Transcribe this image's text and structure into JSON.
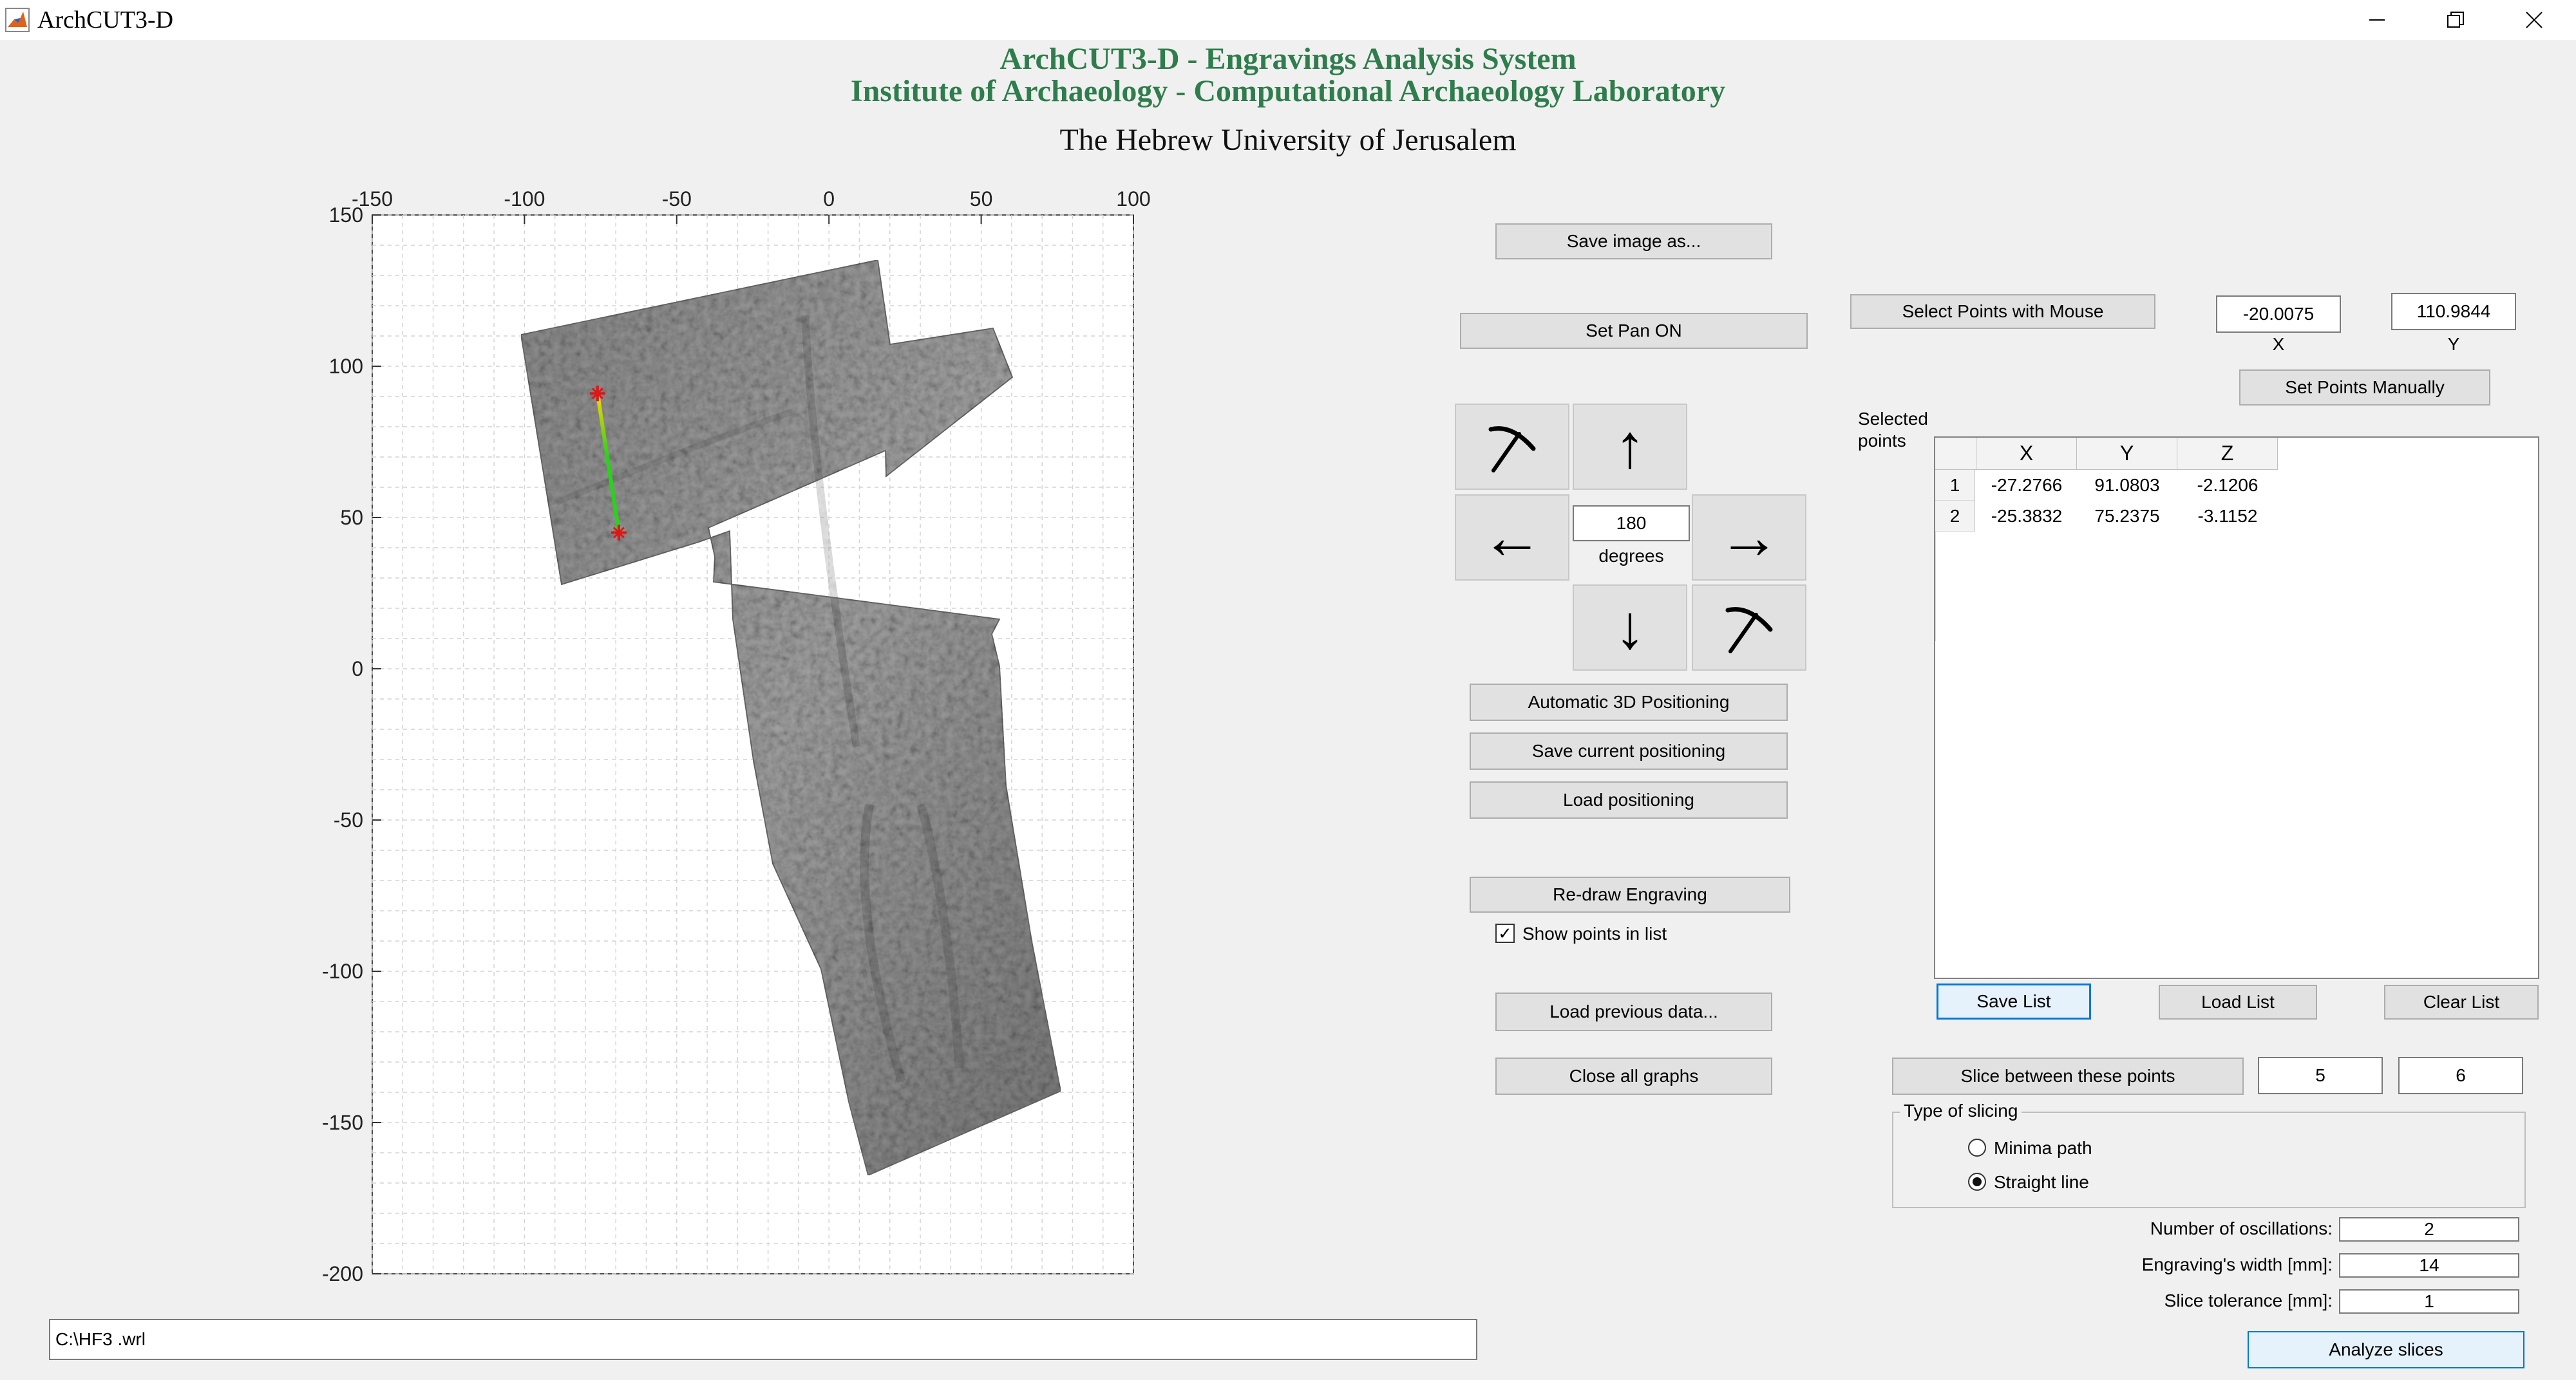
{
  "window": {
    "title": "ArchCUT3-D",
    "controls": [
      "minimize-icon",
      "restore-icon",
      "close-icon"
    ]
  },
  "header": {
    "line1": "ArchCUT3-D  - Engravings Analysis System",
    "line2": "Institute of Archaeology - Computational Archaeology Laboratory",
    "line3": "The Hebrew University of Jerusalem",
    "accent_color": "#2f7d4c"
  },
  "plot": {
    "x_ticks": [
      "-150",
      "-100",
      "-50",
      "0",
      "50",
      "100"
    ],
    "y_ticks": [
      "150",
      "100",
      "50",
      "0",
      "-50",
      "-100",
      "-150",
      "-200"
    ],
    "xlim": [
      -150,
      100
    ],
    "ylim": [
      -200,
      150
    ],
    "grid": "dashed",
    "marker_color": "#e01515",
    "line_color_start": "#ffd500",
    "line_color_end": "#2ad21a",
    "selected_line": [
      [
        -76,
        91
      ],
      [
        -69,
        45
      ]
    ]
  },
  "file_path": "C:\\HF3  .wrl",
  "center_buttons": {
    "save_image": "Save image as...",
    "set_pan": "Set Pan  ON",
    "degrees_value": "180",
    "degrees_label": "degrees",
    "auto_positioning": "Automatic 3D Positioning",
    "save_positioning": "Save current positioning",
    "load_positioning": "Load positioning",
    "redraw": "Re-draw Engraving",
    "show_points": "Show points in list",
    "show_points_checked": true,
    "load_previous": "Load previous data...",
    "close_graphs": "Close all graphs"
  },
  "arrows": {
    "rotate_ccw": "pickaxe-icon",
    "up": "↑",
    "left": "←",
    "right": "→",
    "down": "↓",
    "rotate_cw": "pickaxe-icon"
  },
  "points_panel": {
    "select_mouse": "Select Points with Mouse",
    "x_value": "-20.0075",
    "y_value": "110.9844",
    "x_label": "X",
    "y_label": "Y",
    "set_manually": "Set Points Manually",
    "selected_label_1": "Selected",
    "selected_label_2": "points"
  },
  "table": {
    "columns": [
      "X",
      "Y",
      "Z"
    ],
    "rows": [
      {
        "id": "1",
        "cells": [
          "-27.2766",
          "91.0803",
          "-2.1206"
        ]
      },
      {
        "id": "2",
        "cells": [
          "-25.3832",
          "75.2375",
          "-3.1152"
        ]
      }
    ]
  },
  "list_buttons": {
    "save": "Save List",
    "load": "Load List",
    "clear": "Clear List"
  },
  "slicing": {
    "slice_between": "Slice between these points",
    "from": "5",
    "to": "6",
    "group_title": "Type of slicing",
    "option_minima": "Minima path",
    "option_straight": "Straight line",
    "selected": "Straight line"
  },
  "params": {
    "oscillations_label": "Number of oscillations:",
    "oscillations_value": "2",
    "width_label": "Engraving's width [mm]:",
    "width_value": "14",
    "tolerance_label": "Slice tolerance [mm]:",
    "tolerance_value": "1",
    "analyze": "Analyze slices"
  }
}
